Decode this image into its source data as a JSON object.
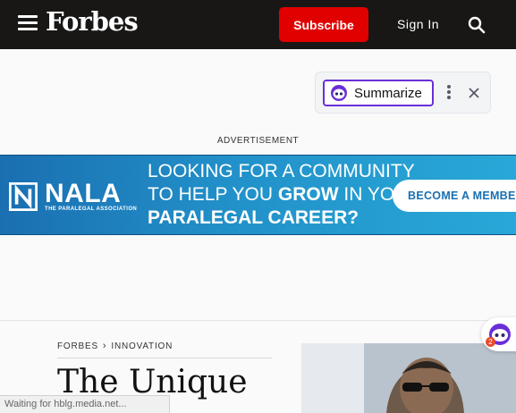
{
  "header": {
    "logo": "Forbes",
    "subscribe_label": "Subscribe",
    "signin_label": "Sign In",
    "icons": {
      "menu": "hamburger-menu-icon",
      "search": "search-icon"
    },
    "colors": {
      "bar": "#181716",
      "subscribe": "#e00000"
    }
  },
  "summarize": {
    "label": "Summarize",
    "icons": {
      "face": "robot-face-icon",
      "more": "more-vertical-icon",
      "close": "close-icon"
    },
    "accent": "#6a2fd8"
  },
  "advertisement": {
    "label": "ADVERTISEMENT",
    "banner": {
      "brand": "NALA",
      "brand_sub": "THE PARALEGAL ASSOCIATION",
      "line1": "LOOKING FOR A COMMUNITY",
      "line2_pre": "TO HELP YOU",
      "line2_bold": "GROW",
      "line2_post": "IN YOUR",
      "line3": "PARALEGAL CAREER?",
      "cta": "BECOME A MEMBER"
    }
  },
  "article": {
    "breadcrumb": [
      "FORBES",
      "INNOVATION"
    ],
    "headline": "The Unique"
  },
  "chat": {
    "badge_count": "2",
    "icon": "chat-assistant-icon"
  },
  "status_bar": "Waiting for hblg.media.net..."
}
